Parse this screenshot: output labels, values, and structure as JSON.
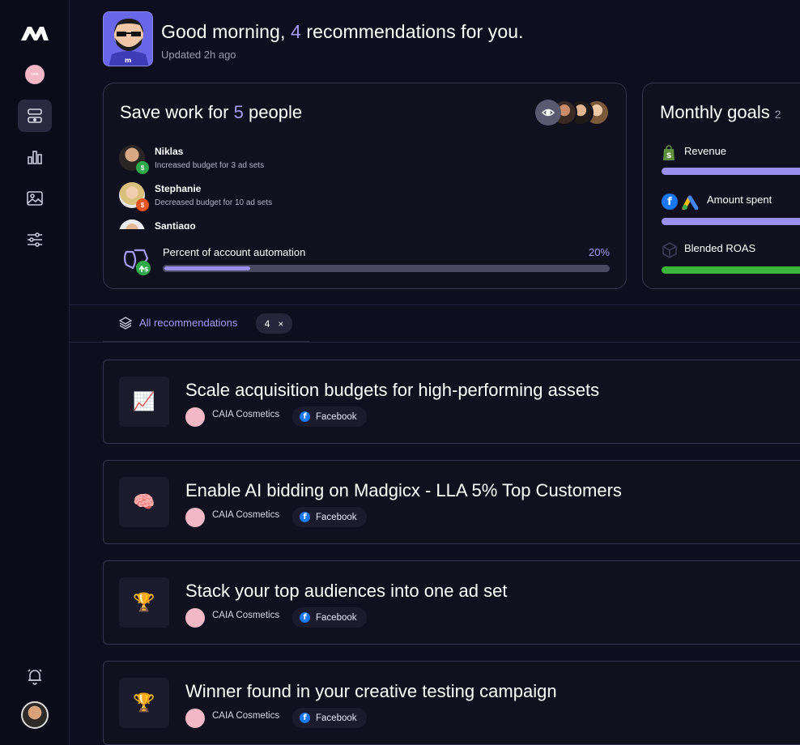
{
  "colors": {
    "accent": "#a59bf6",
    "background": "#0f0e1f",
    "border": "#35344c",
    "success": "#3cb53c",
    "facebook": "#1877f2"
  },
  "sidebar": {
    "brand_logo": "brand-logo",
    "brand_account": "caia",
    "items": [
      "automation-icon",
      "chart-icon",
      "image-icon",
      "sliders-icon"
    ],
    "bottom": [
      "bell-icon",
      "user-avatar"
    ]
  },
  "header": {
    "greeting_prefix": "Good morning,",
    "recommendation_count": "4",
    "greeting_suffix": "recommendations for you.",
    "updated": "Updated 2h ago"
  },
  "save_card": {
    "title_prefix": "Save work for",
    "people_count": "5",
    "title_suffix": "people",
    "people": [
      {
        "name": "Niklas",
        "desc": "Increased budget for 3 ad sets",
        "badge": "budget-up-icon"
      },
      {
        "name": "Stephanie",
        "desc": "Decreased budget for 10 ad sets",
        "badge": "budget-down-icon"
      },
      {
        "name": "Santiago",
        "desc": "",
        "badge": ""
      }
    ],
    "automation_label": "Percent of account automation",
    "automation_percent": "20%",
    "automation_fraction": 0.2
  },
  "goals_card": {
    "title": "Monthly goals",
    "count": "2",
    "goals": [
      {
        "label": "Revenue",
        "icon": "shopify-icon",
        "color": "#9b8ff0"
      },
      {
        "label": "Amount spent",
        "icon": "facebook-google-ads-icon",
        "color": "#9b8ff0"
      },
      {
        "label": "Blended ROAS",
        "icon": "cube-icon",
        "color": "#3cb53c"
      }
    ]
  },
  "tabs": {
    "all_label": "All recommendations",
    "count": "4",
    "clear": "×"
  },
  "recommendations": [
    {
      "emoji": "📈",
      "title": "Scale acquisition budgets for high-performing assets",
      "brand": "CAIA Cosmetics",
      "platform": "Facebook"
    },
    {
      "emoji": "🧠",
      "title": "Enable AI bidding on Madgicx - LLA 5% Top Customers",
      "brand": "CAIA Cosmetics",
      "platform": "Facebook"
    },
    {
      "emoji": "🏆",
      "title": "Stack your top audiences into one ad set",
      "brand": "CAIA Cosmetics",
      "platform": "Facebook"
    },
    {
      "emoji": "🏆",
      "title": "Winner found in your creative testing campaign",
      "brand": "CAIA Cosmetics",
      "platform": "Facebook"
    }
  ]
}
